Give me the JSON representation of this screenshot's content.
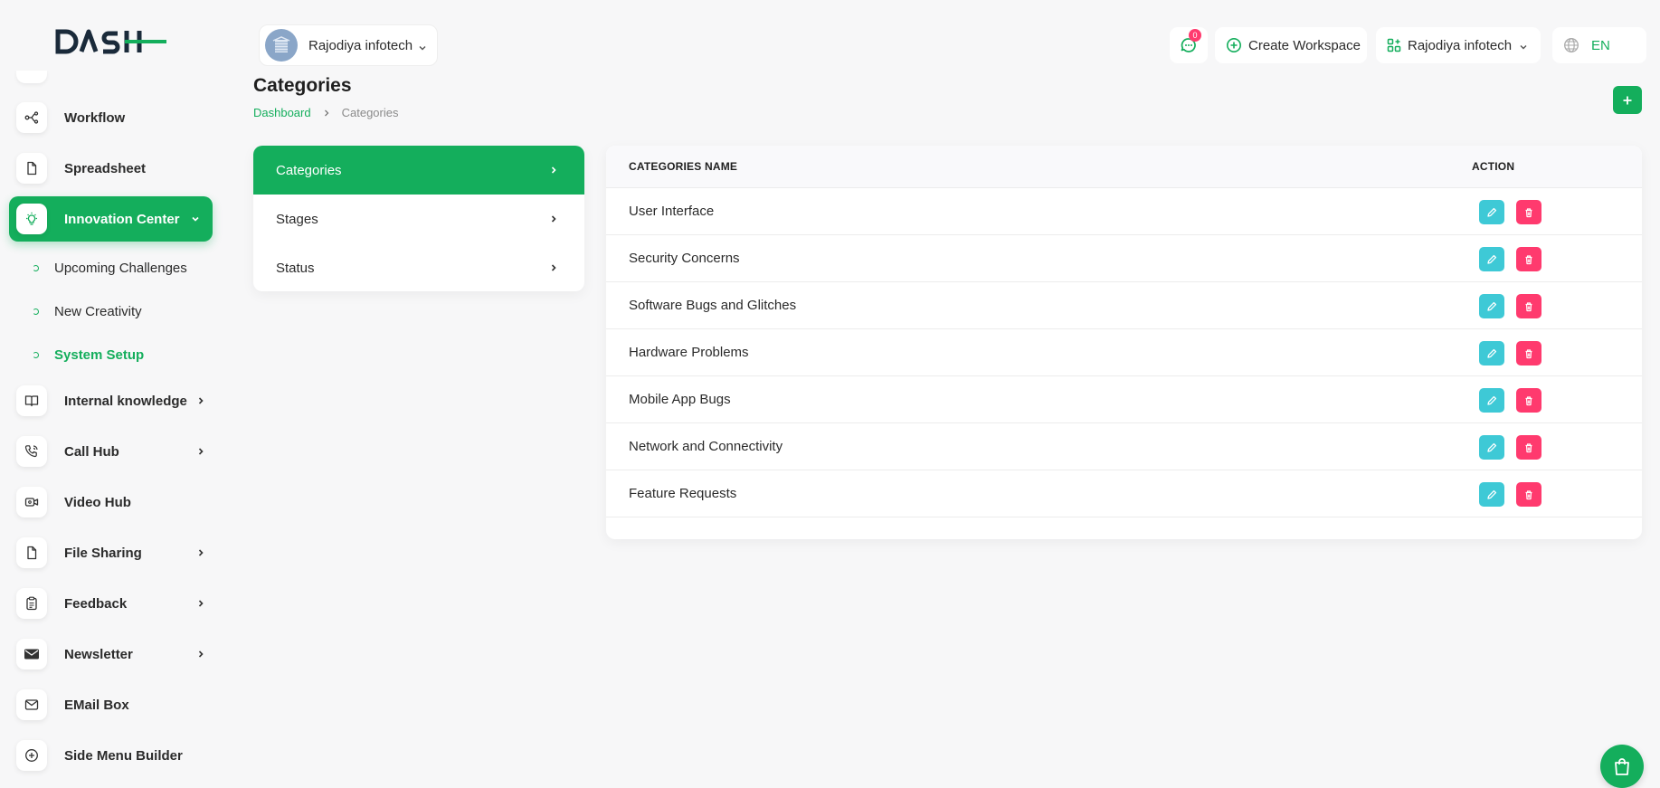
{
  "app": {
    "logo_text": "DASH",
    "colors": {
      "primary": "#14ae5c",
      "edit": "#3ec9d6",
      "delete": "#ff3a6e",
      "badge": "#ff3a6e"
    }
  },
  "sidebar": {
    "items": [
      {
        "label": "Workflow",
        "icon": "workflow-icon"
      },
      {
        "label": "Spreadsheet",
        "icon": "file-icon"
      },
      {
        "label": "Innovation Center",
        "icon": "lightbulb-icon",
        "active": true,
        "expanded": true
      },
      {
        "label": "Internal knowledge",
        "icon": "book-icon",
        "has_children": true
      },
      {
        "label": "Call Hub",
        "icon": "phone-icon",
        "has_children": true
      },
      {
        "label": "Video Hub",
        "icon": "video-icon"
      },
      {
        "label": "File Sharing",
        "icon": "file-icon",
        "has_children": true
      },
      {
        "label": "Feedback",
        "icon": "clipboard-icon",
        "has_children": true
      },
      {
        "label": "Newsletter",
        "icon": "envelope-icon",
        "has_children": true
      },
      {
        "label": "EMail Box",
        "icon": "mail-icon"
      },
      {
        "label": "Side Menu Builder",
        "icon": "plus-circle-icon"
      }
    ],
    "subitems": [
      {
        "label": "Upcoming Challenges"
      },
      {
        "label": "New Creativity"
      },
      {
        "label": "System Setup",
        "current": true
      }
    ]
  },
  "header": {
    "workspace_name": "Rajodiya infotech",
    "notifications_count": "0",
    "create_workspace_label": "Create Workspace",
    "user_name": "Rajodiya infotech",
    "language": "EN"
  },
  "page": {
    "title": "Categories",
    "breadcrumb": {
      "home": "Dashboard",
      "current": "Categories"
    }
  },
  "setup_menu": [
    {
      "label": "Categories",
      "active": true
    },
    {
      "label": "Stages"
    },
    {
      "label": "Status"
    }
  ],
  "table": {
    "columns": {
      "name": "CATEGORIES NAME",
      "action": "ACTION"
    },
    "rows": [
      "User Interface",
      "Security Concerns",
      "Software Bugs and Glitches",
      "Hardware Problems",
      "Mobile App Bugs",
      "Network and Connectivity",
      "Feature Requests"
    ]
  }
}
